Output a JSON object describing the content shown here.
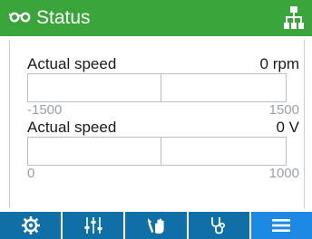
{
  "header": {
    "title": "Status",
    "icons": [
      "glasses-icon",
      "network-topology-icon"
    ],
    "color": "#3aa53a"
  },
  "readings": [
    {
      "label": "Actual speed",
      "value": "0 rpm",
      "min": "-1500",
      "max": "1500",
      "fill_fraction": 0
    },
    {
      "label": "Actual speed",
      "value": "0 V",
      "min": "0",
      "max": "1000",
      "fill_fraction": 0
    }
  ],
  "nav": {
    "items": [
      "settings-gear-icon",
      "sliders-icon",
      "hand-wrench-icon",
      "stethoscope-icon",
      "menu-icon"
    ],
    "active_index": 4,
    "color": "#0f6fa6",
    "active_color": "#1e88e5"
  }
}
